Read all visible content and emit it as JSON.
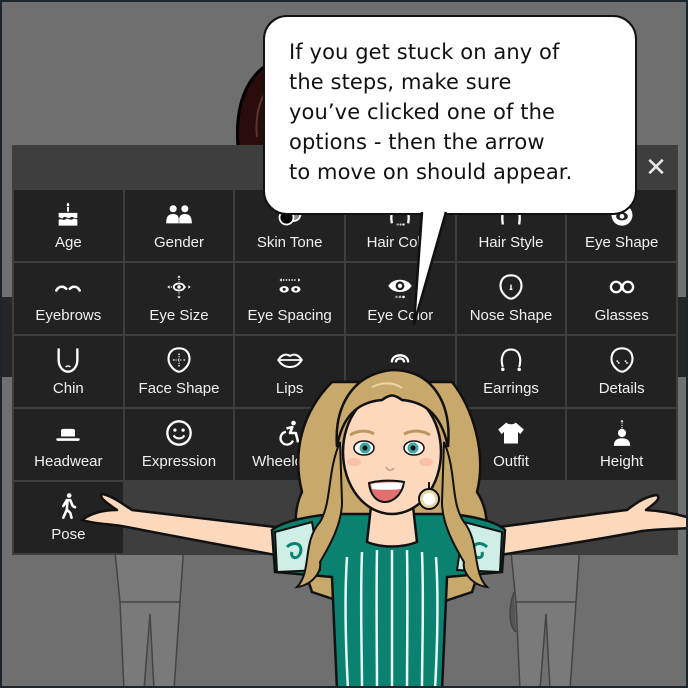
{
  "bubble": {
    "lines": [
      "If you get stuck on any of",
      "the steps, make sure",
      "you’ve clicked one of the",
      "options - then the arrow",
      "to move on should appear."
    ]
  },
  "panel": {
    "close_label": "✕",
    "options": [
      {
        "label": "Age",
        "icon": "cake-icon"
      },
      {
        "label": "Gender",
        "icon": "people-icon"
      },
      {
        "label": "Skin Tone",
        "icon": "skin-tone-icon"
      },
      {
        "label": "Hair Color",
        "icon": "hair-color-icon"
      },
      {
        "label": "Hair Style",
        "icon": "hair-style-icon"
      },
      {
        "label": "Eye Shape",
        "icon": "eye-shape-icon"
      },
      {
        "label": "Eyebrows",
        "icon": "eyebrows-icon"
      },
      {
        "label": "Eye Size",
        "icon": "eye-size-icon"
      },
      {
        "label": "Eye Spacing",
        "icon": "eye-spacing-icon"
      },
      {
        "label": "Eye Color",
        "icon": "eye-color-icon"
      },
      {
        "label": "Nose Shape",
        "icon": "nose-shape-icon"
      },
      {
        "label": "Glasses",
        "icon": "glasses-icon"
      },
      {
        "label": "Chin",
        "icon": "chin-icon"
      },
      {
        "label": "Face Shape",
        "icon": "face-shape-icon"
      },
      {
        "label": "Lips",
        "icon": "lips-icon"
      },
      {
        "label": "",
        "icon": "ear-icon",
        "obscured": true
      },
      {
        "label": "Earrings",
        "icon": "earrings-icon"
      },
      {
        "label": "Details",
        "icon": "face-details-icon"
      },
      {
        "label": "Headwear",
        "icon": "hat-icon"
      },
      {
        "label": "Expression",
        "icon": "smiley-icon"
      },
      {
        "label": "Wheelchair",
        "icon": "wheelchair-icon"
      },
      {
        "label": "",
        "icon": "unknown-icon",
        "obscured": true
      },
      {
        "label": "Outfit",
        "icon": "shirt-icon"
      },
      {
        "label": "Height",
        "icon": "height-icon"
      },
      {
        "label": "Pose",
        "icon": "walking-person-icon"
      }
    ]
  },
  "colors": {
    "background": "#6f6f6f",
    "panel": "#3e3e3e",
    "cell": "#222222",
    "label": "#f0f0f0",
    "bubble": "#ffffff",
    "hair": "#c9a96b",
    "skin": "#fcd8bd",
    "top": "#0b8170"
  }
}
